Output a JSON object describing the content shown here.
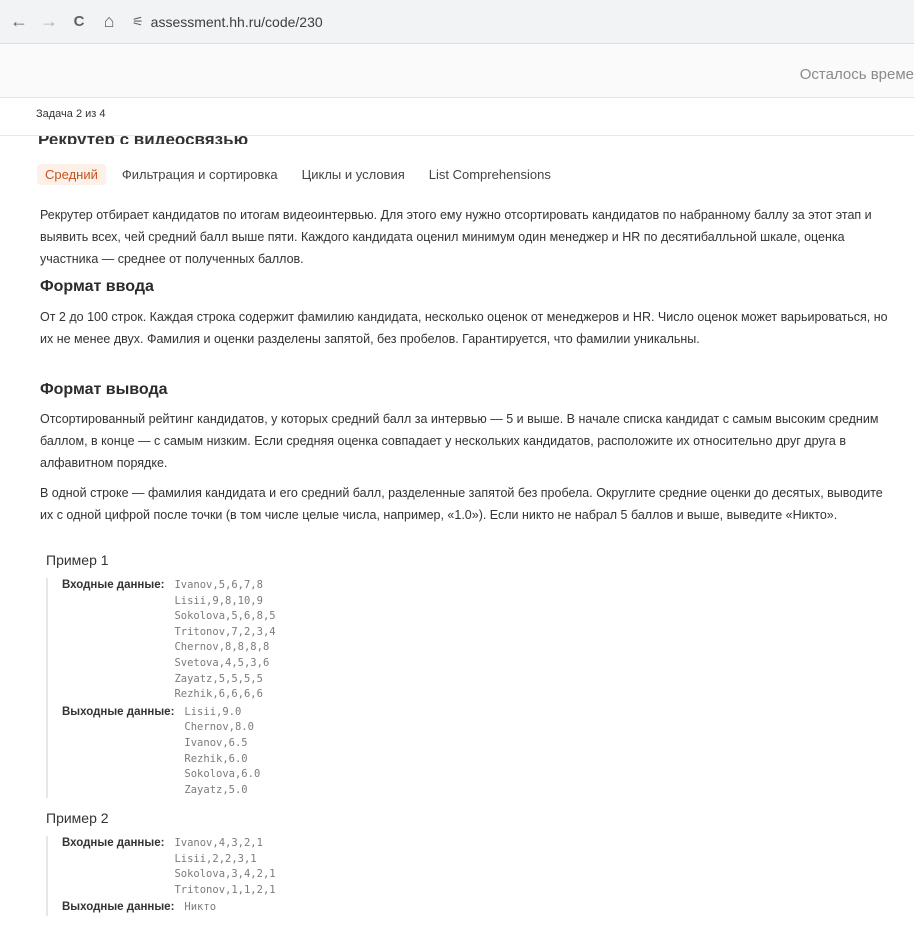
{
  "browser": {
    "url": "assessment.hh.ru/code/230",
    "back_icon": "←",
    "forward_icon": "→",
    "reload_icon": "C",
    "home_icon": "⌂",
    "site_info_icon": "⚟"
  },
  "header": {
    "timer_label": "Осталось време"
  },
  "task_tab": {
    "counter": "Задача 2 из 4"
  },
  "task": {
    "title": "Рекрутер с видеосвязью",
    "tags": [
      "Средний",
      "Фильтрация и сортировка",
      "Циклы и условия",
      "List Comprehensions"
    ],
    "description": "Рекрутер отбирает кандидатов по итогам видеоинтервью. Для этого ему нужно отсортировать кандидатов по набранному баллу за этот этап и выявить всех, чей средний балл выше пяти. Каждого кандидата оценил минимум один менеджер и HR по десятибалльной шкале, оценка участника — среднее от полученных баллов.",
    "input_heading": "Формат ввода",
    "input_text": "От 2 до 100 строк. Каждая строка содержит фамилию кандидата, несколько оценок от менеджеров и HR. Число оценок может варьироваться, но их не менее двух. Фамилия и оценки разделены запятой, без пробелов. Гарантируется, что фамилии уникальны.",
    "output_heading": "Формат вывода",
    "output_text_1": "Отсортированный рейтинг кандидатов, у которых средний балл за интервью — 5 и выше. В начале списка кандидат с самым высоким средним баллом, в конце — с самым низким. Если средняя оценка совпадает у нескольких кандидатов, расположите их относительно друг друга в алфавитном порядке.",
    "output_text_2": "В одной строке — фамилия кандидата и его средний балл, разделенные запятой без пробела. Округлите средние оценки до десятых, выводите их с одной цифрой после точки (в том числе целые числа, например, «1.0»). Если никто не набрал 5 баллов и выше, выведите «Никто»."
  },
  "examples": [
    {
      "title": "Пример 1",
      "input_label": "Входные данные:",
      "input_lines": [
        "Ivanov,5,6,7,8",
        "Lisii,9,8,10,9",
        "Sokolova,5,6,8,5",
        "Tritonov,7,2,3,4",
        "Chernov,8,8,8,8",
        "Svetova,4,5,3,6",
        "Zayatz,5,5,5,5",
        "Rezhik,6,6,6,6"
      ],
      "output_label": "Выходные данные:",
      "output_lines": [
        "Lisii,9.0",
        "Chernov,8.0",
        "Ivanov,6.5",
        "Rezhik,6.0",
        "Sokolova,6.0",
        "Zayatz,5.0"
      ]
    },
    {
      "title": "Пример 2",
      "input_label": "Входные данные:",
      "input_lines": [
        "Ivanov,4,3,2,1",
        "Lisii,2,2,3,1",
        "Sokolova,3,4,2,1",
        "Tritonov,1,1,2,1"
      ],
      "output_label": "Выходные данные:",
      "output_lines": [
        "Никто"
      ]
    }
  ]
}
